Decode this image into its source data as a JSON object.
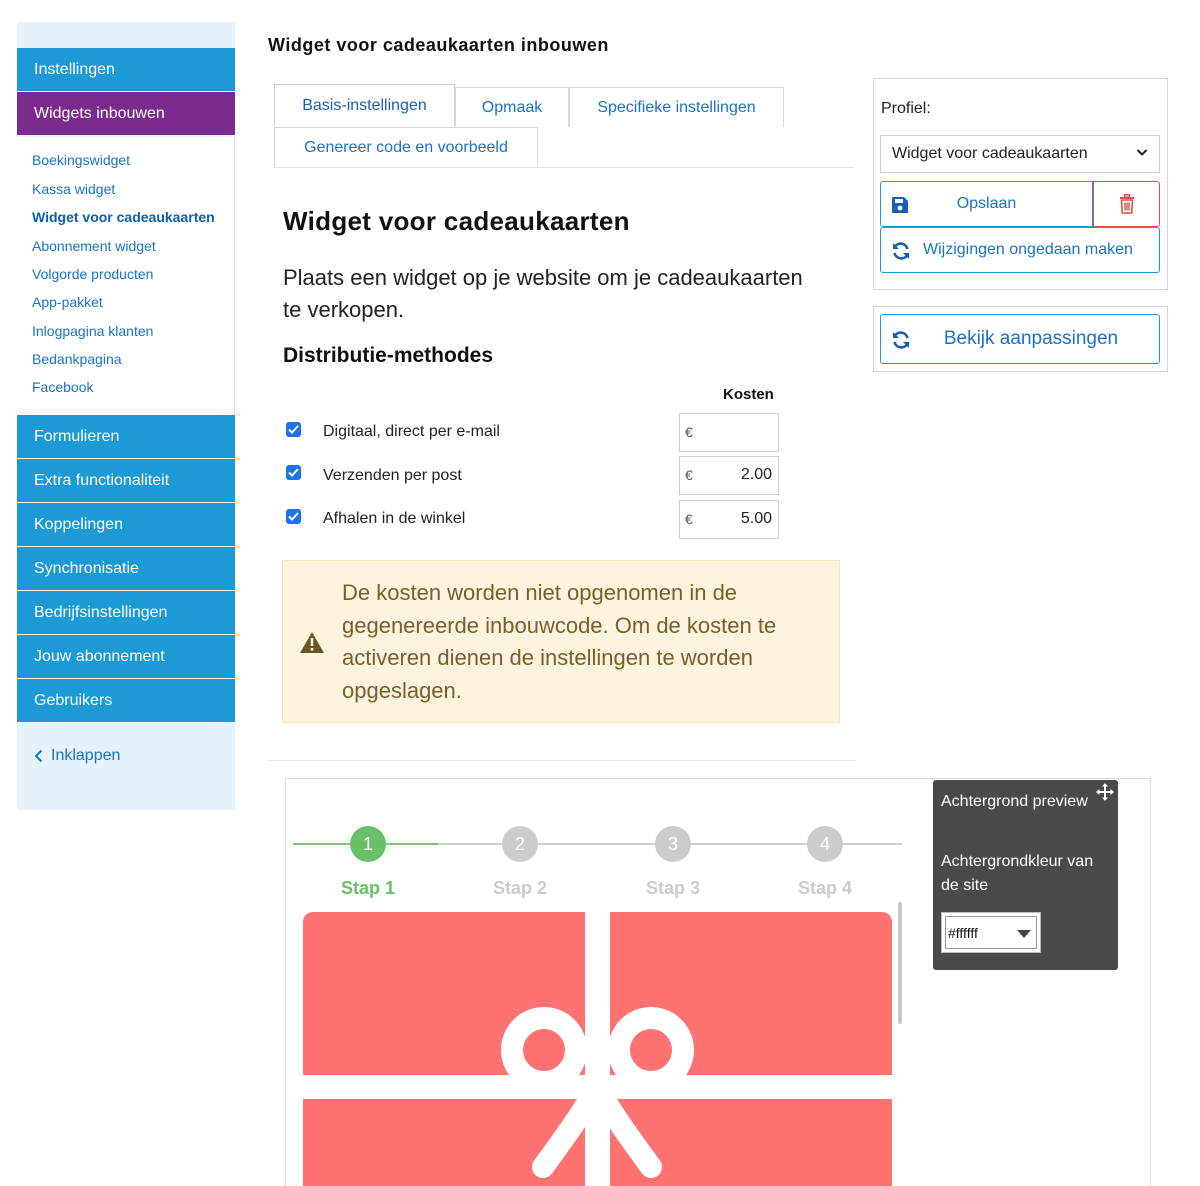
{
  "sidebar": {
    "top_items": [
      {
        "label": "Instellingen"
      },
      {
        "label": "Widgets inbouwen"
      }
    ],
    "sub_items": [
      {
        "label": "Boekingswidget"
      },
      {
        "label": "Kassa widget"
      },
      {
        "label": "Widget voor cadeaukaarten"
      },
      {
        "label": "Abonnement widget"
      },
      {
        "label": "Volgorde producten"
      },
      {
        "label": "App-pakket"
      },
      {
        "label": "Inlogpagina klanten"
      },
      {
        "label": "Bedankpagina"
      },
      {
        "label": "Facebook"
      }
    ],
    "bottom_items": [
      {
        "label": "Formulieren"
      },
      {
        "label": "Extra functionaliteit"
      },
      {
        "label": "Koppelingen"
      },
      {
        "label": "Synchronisatie"
      },
      {
        "label": "Bedrijfsinstellingen"
      },
      {
        "label": "Jouw abonnement"
      },
      {
        "label": "Gebruikers"
      }
    ],
    "collapse_label": "Inklappen"
  },
  "page": {
    "title": "Widget voor cadeaukaarten inbouwen"
  },
  "tabs": [
    {
      "label": "Basis-instellingen"
    },
    {
      "label": "Opmaak"
    },
    {
      "label": "Specifieke instellingen"
    },
    {
      "label": "Genereer code en voorbeeld"
    }
  ],
  "content": {
    "heading": "Widget voor cadeaukaarten",
    "intro": "Plaats een widget op je website om je cadeaukaarten te verkopen.",
    "distribution_heading": "Distributie-methodes",
    "cost_column_label": "Kosten",
    "currency_symbol": "€",
    "methods": [
      {
        "label": "Digitaal, direct per e-mail",
        "checked": true,
        "cost": ""
      },
      {
        "label": "Verzenden per post",
        "checked": true,
        "cost": "2.00"
      },
      {
        "label": "Afhalen in de winkel",
        "checked": true,
        "cost": "5.00"
      }
    ],
    "warning": "De kosten worden niet opgenomen in de gegenereerde inbouwcode. Om de kosten te activeren dienen de instellingen te worden opgeslagen."
  },
  "profile_panel": {
    "label": "Profiel:",
    "selected": "Widget voor cadeaukaarten",
    "save_label": "Opslaan",
    "undo_label": "Wijzigingen ongedaan maken",
    "view_changes_label": "Bekijk aanpassingen"
  },
  "preview": {
    "steps": [
      {
        "number": "1",
        "label": "Stap 1",
        "active": true
      },
      {
        "number": "2",
        "label": "Stap 2",
        "active": false
      },
      {
        "number": "3",
        "label": "Stap 3",
        "active": false
      },
      {
        "number": "4",
        "label": "Stap 4",
        "active": false
      }
    ],
    "background_panel": {
      "title": "Achtergrond preview",
      "color_label": "Achtergrondkleur van de site",
      "color_value": "#ffffff"
    }
  },
  "colors": {
    "sidebar_blue": "#1c9ad6",
    "sidebar_active_purple": "#7b2a8e",
    "link_blue": "#1a73c8",
    "step_active_green": "#6abf69",
    "step_inactive_grey": "#cccccc",
    "gift_card_red": "#ff7272",
    "warning_bg": "#fcf4df",
    "delete_red": "#d9534f"
  },
  "icons": {
    "save": "floppy-disk-icon",
    "delete": "trash-icon",
    "undo": "refresh-icon",
    "view": "refresh-icon",
    "warning": "warning-triangle-icon",
    "move": "move-arrows-icon",
    "collapse": "chevron-left-icon",
    "select": "chevron-down-icon"
  }
}
